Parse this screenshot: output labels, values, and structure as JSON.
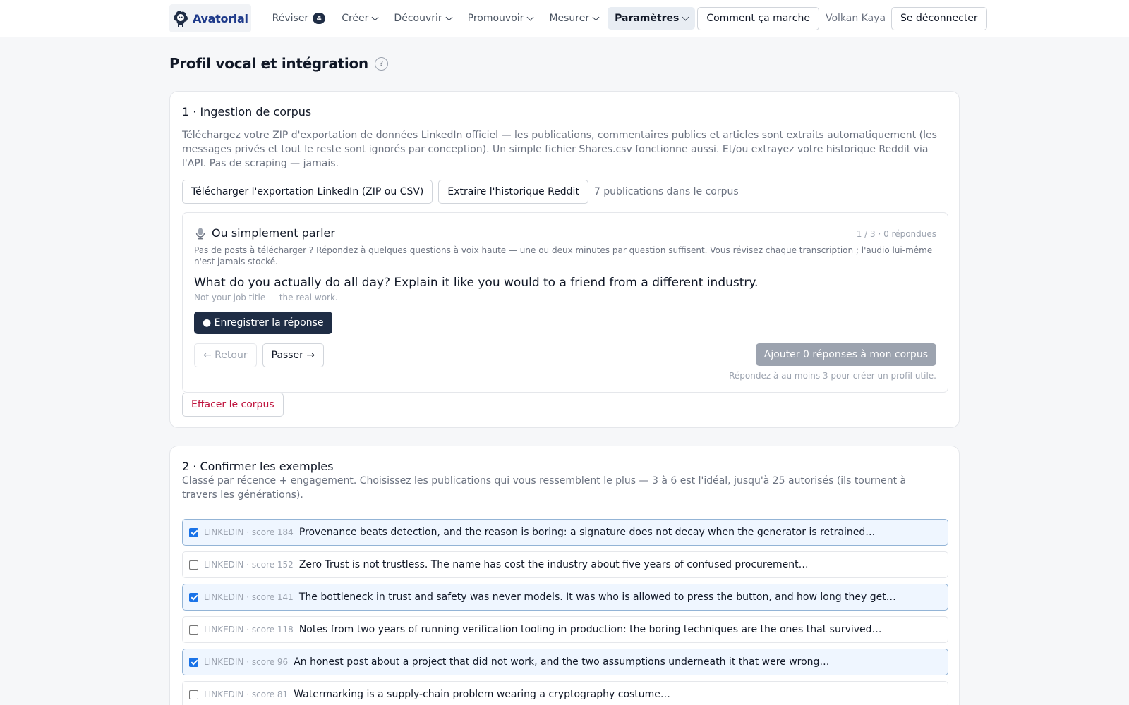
{
  "nav": {
    "logo_text": "Avatorial",
    "items": [
      {
        "label": "Réviser",
        "badge": "4"
      },
      {
        "label": "Créer"
      },
      {
        "label": "Découvrir"
      },
      {
        "label": "Promouvoir"
      },
      {
        "label": "Mesurer"
      },
      {
        "label": "Paramètres",
        "active": true
      }
    ],
    "how_it_works": "Comment ça marche",
    "username": "Volkan Kaya",
    "logout": "Se déconnecter"
  },
  "page": {
    "title": "Profil vocal et intégration",
    "help": "?"
  },
  "ingestion": {
    "title": "1 · Ingestion de corpus",
    "description": "Téléchargez votre ZIP d'exportation de données LinkedIn officiel — les publications, commentaires publics et articles sont extraits automatiquement (les messages privés et tout le reste sont ignorés par conception). Un simple fichier Shares.csv fonctionne aussi. Et/ou extrayez votre historique Reddit via l'API. Pas de scraping — jamais.",
    "upload_linkedin": "Télécharger l'exportation LinkedIn (ZIP ou CSV)",
    "fetch_reddit": "Extraire l'historique Reddit",
    "corpus_count": "7 publications dans le corpus",
    "voice": {
      "title": "Ou simplement parler",
      "progress": "1 / 3 · 0 répondues",
      "description": "Pas de posts à télécharger ? Répondez à quelques questions à voix haute — une ou deux minutes par question suffisent. Vous révisez chaque transcription ; l'audio lui-même n'est jamais stocké.",
      "question": "What do you actually do all day? Explain it like you would to a friend from a different industry.",
      "hint": "Not your job title — the real work.",
      "record": "● Enregistrer la réponse",
      "back": "← Retour",
      "skip": "Passer →",
      "add": "Ajouter 0 réponses à mon corpus",
      "add_hint": "Répondez à au moins 3 pour créer un profil utile."
    },
    "clear": "Effacer le corpus"
  },
  "examples": {
    "title": "2 · Confirmer les exemples",
    "description": "Classé par récence + engagement. Choisissez les publications qui vous ressemblent le plus — 3 à 6 est l'idéal, jusqu'à 25 autorisés (ils tournent à travers les générations).",
    "rows": [
      {
        "checked": true,
        "meta": "LINKEDIN · score 184",
        "text": "Provenance beats detection, and the reason is boring: a signature does not decay when the generator is retrained…"
      },
      {
        "checked": false,
        "meta": "LINKEDIN · score 152",
        "text": "Zero Trust is not trustless. The name has cost the industry about five years of confused procurement…"
      },
      {
        "checked": true,
        "meta": "LINKEDIN · score 141",
        "text": "The bottleneck in trust and safety was never models. It was who is allowed to press the button, and how long they get…"
      },
      {
        "checked": false,
        "meta": "LINKEDIN · score 118",
        "text": "Notes from two years of running verification tooling in production: the boring techniques are the ones that survived…"
      },
      {
        "checked": true,
        "meta": "LINKEDIN · score 96",
        "text": "An honest post about a project that did not work, and the two assumptions underneath it that were wrong…"
      },
      {
        "checked": false,
        "meta": "LINKEDIN · score 81",
        "text": "Watermarking is a supply-chain problem wearing a cryptography costume…"
      }
    ]
  },
  "colors": {
    "primary": "#1f2d45",
    "danger": "#be123c",
    "selected_bg": "#eff6ff",
    "checkbox": "#1a73e8"
  }
}
